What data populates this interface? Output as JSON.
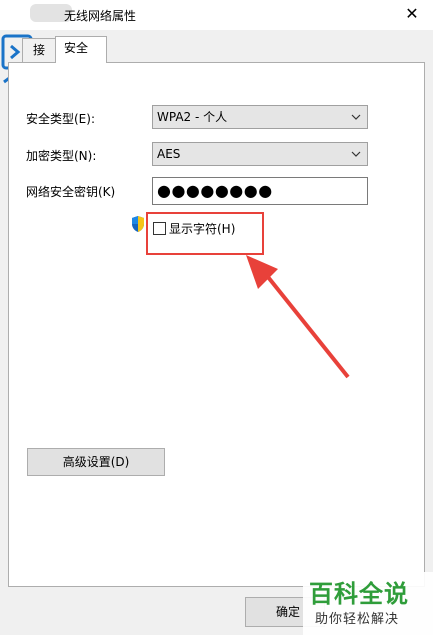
{
  "window": {
    "title": "无线网络属性",
    "close_glyph": "✕"
  },
  "tabs": [
    {
      "label": "接"
    },
    {
      "label": "安全"
    }
  ],
  "security_type": {
    "label": "安全类型(E):",
    "value": "WPA2 - 个人"
  },
  "encryption_type": {
    "label": "加密类型(N):",
    "value": "AES"
  },
  "network_key": {
    "label": "网络安全密钥(K)",
    "value": "●●●●●●●●"
  },
  "show_chars": {
    "label": "显示字符(H)",
    "checked": false
  },
  "advanced_button": {
    "label": "高级设置(D)"
  },
  "ok_button": {
    "label": "确定"
  },
  "watermark": {
    "title": "百科全说",
    "subtitle": "助你轻松解决"
  },
  "colors": {
    "highlight": "#e8413a",
    "arrow": "#e8413a",
    "watermark_green": "#2f9d3a",
    "logo_blue": "#1a73c8"
  },
  "icons": {
    "shield": "uac-shield-icon",
    "chevron": "chevron-down-icon",
    "close": "close-icon"
  }
}
